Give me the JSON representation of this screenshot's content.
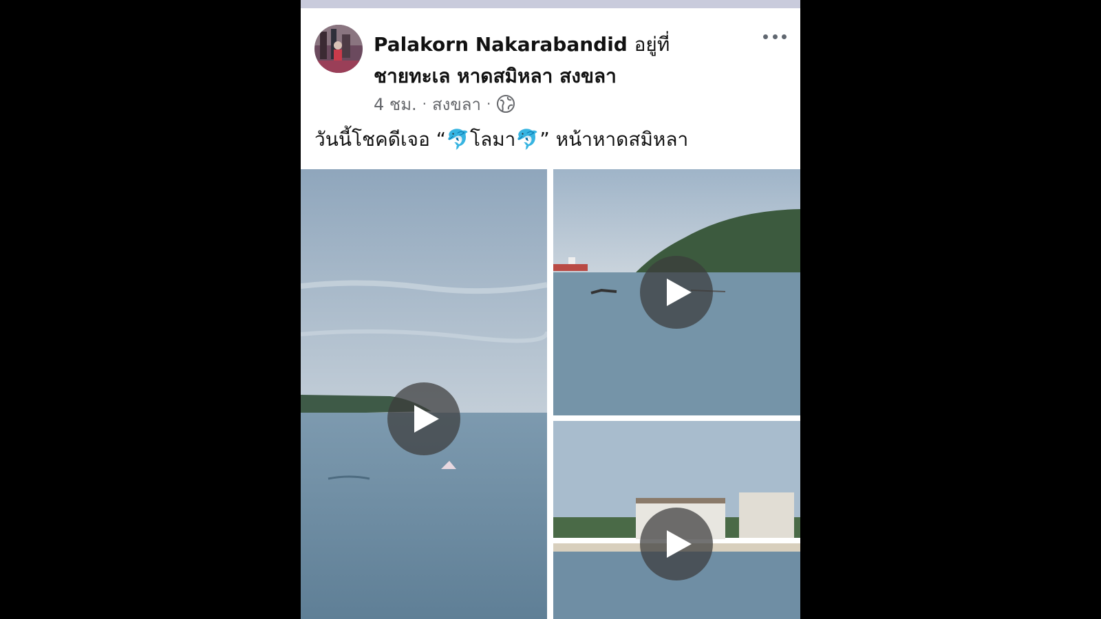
{
  "post": {
    "author": "Palakorn Nakarabandid",
    "at_text": "อยู่ที่",
    "location": "ชายทะเล หาดสมิหลา สงขลา",
    "time": "4 ชม.",
    "place": "สงขลา",
    "separator": "·",
    "caption": "วันนี้โชคดีเจอ “🐬โลมา🐬” หน้าหาดสมิหลา",
    "privacy_icon": "globe-icon",
    "menu_icon": "more-icon"
  },
  "media": [
    {
      "kind": "video",
      "scene": "open sea with dolphin fin",
      "icon": "play-icon"
    },
    {
      "kind": "video",
      "scene": "hill and ship over sea",
      "icon": "play-icon"
    },
    {
      "kind": "video",
      "scene": "hotel by the shore",
      "icon": "play-icon"
    }
  ],
  "colors": {
    "header_bar": "#c9cbdc",
    "text": "#111111",
    "meta_text": "#65676b",
    "sea": "#6f8fa6",
    "sky": "#b9c8d6"
  }
}
